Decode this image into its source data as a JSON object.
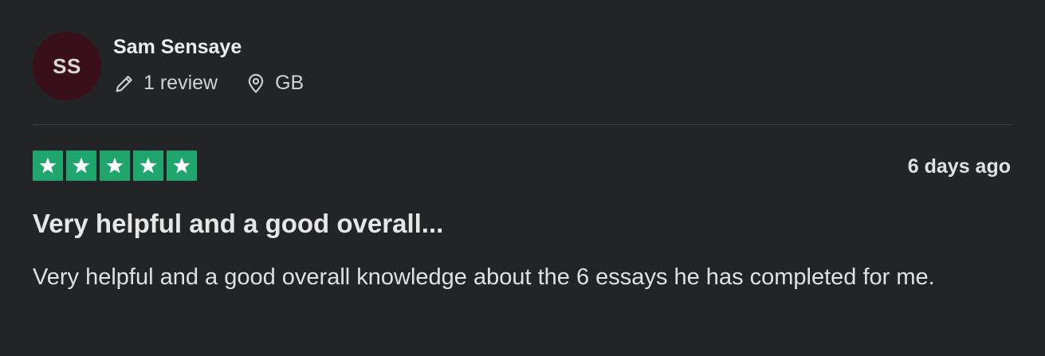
{
  "reviewer": {
    "initials": "SS",
    "name": "Sam Sensaye",
    "review_count": "1 review",
    "location": "GB",
    "avatar_color": "#3a0f1c"
  },
  "review": {
    "rating": 5,
    "rating_max": 5,
    "star_color": "#1fa66f",
    "date": "6 days ago",
    "title": "Very helpful and a good overall...",
    "body": "Very helpful and a good overall knowledge about the 6 essays he has completed for me."
  },
  "icons": {
    "review_icon": "pencil-icon",
    "location_icon": "location-pin-icon",
    "star_icon": "star-icon"
  }
}
